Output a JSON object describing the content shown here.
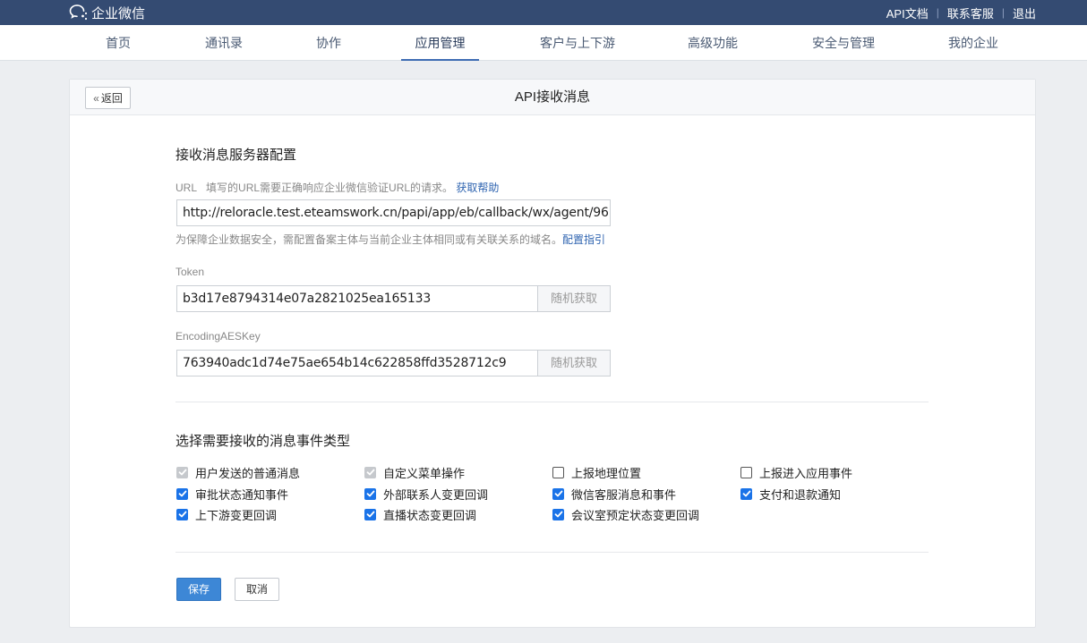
{
  "brand": {
    "name": "企业微信",
    "icon": "wechat-work-logo-icon"
  },
  "top_links": [
    "API文档",
    "联系客服",
    "退出"
  ],
  "nav": {
    "items": [
      "首页",
      "通讯录",
      "协作",
      "应用管理",
      "客户与上下游",
      "高级功能",
      "安全与管理",
      "我的企业"
    ],
    "active": "应用管理"
  },
  "panel": {
    "back_label": "返回",
    "title": "API接收消息"
  },
  "server_config": {
    "title": "接收消息服务器配置",
    "url_label": "URL",
    "url_desc": "填写的URL需要正确响应企业微信验证URL的请求。",
    "url_help_link": "获取帮助",
    "url_value": "http://reloracle.test.eteamswork.cn/papi/app/eb/callback/wx/agent/96",
    "url_hint": "为保障企业数据安全，需配置备案主体与当前企业主体相同或有关联关系的域名。",
    "url_hint_link": "配置指引",
    "token_label": "Token",
    "token_value": "b3d17e8794314e07a2821025ea165133",
    "aes_label": "EncodingAESKey",
    "aes_value": "763940adc1d74e75ae654b14c622858ffd3528712c9",
    "random_label": "随机获取"
  },
  "events": {
    "title": "选择需要接收的消息事件类型",
    "items": [
      {
        "label": "用户发送的普通消息",
        "state": "disabled"
      },
      {
        "label": "自定义菜单操作",
        "state": "disabled"
      },
      {
        "label": "上报地理位置",
        "state": "unchecked"
      },
      {
        "label": "上报进入应用事件",
        "state": "unchecked"
      },
      {
        "label": "审批状态通知事件",
        "state": "checked"
      },
      {
        "label": "外部联系人变更回调",
        "state": "checked"
      },
      {
        "label": "微信客服消息和事件",
        "state": "checked"
      },
      {
        "label": "支付和退款通知",
        "state": "checked"
      },
      {
        "label": "上下游变更回调",
        "state": "checked"
      },
      {
        "label": "直播状态变更回调",
        "state": "checked"
      },
      {
        "label": "会议室预定状态变更回调",
        "state": "checked"
      }
    ]
  },
  "actions": {
    "save": "保存",
    "cancel": "取消"
  },
  "colors": {
    "topbar": "#344b72",
    "primary": "#3d87d6",
    "checkbox": "#1a73e8",
    "link": "#2f64b0"
  }
}
